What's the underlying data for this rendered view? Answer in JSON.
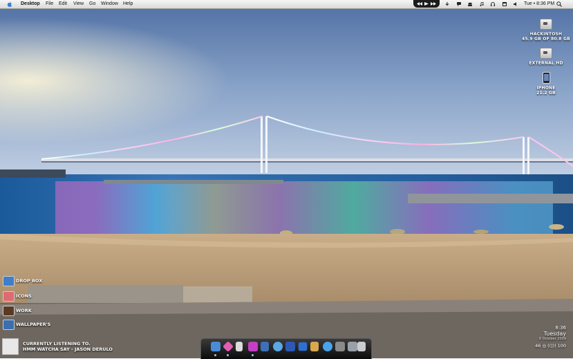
{
  "menubar": {
    "app_name": "Desktop",
    "menus": [
      "File",
      "Edit",
      "View",
      "Go",
      "Window",
      "Help"
    ],
    "clock": "Tue • 8:36 PM"
  },
  "desktop_icons": [
    {
      "name": "HACKINTOSH",
      "sub": "45.9 GB OF 80.8 GB",
      "icon": "hard-drive-icon"
    },
    {
      "name": "EXTERNAL HD",
      "sub": "",
      "icon": "hard-drive-icon"
    },
    {
      "name": "IPHONE",
      "sub": "21.2 GB",
      "icon": "iphone-icon"
    }
  ],
  "shortcuts": [
    {
      "label": "DROP BOX",
      "icon": "dropbox-icon",
      "color": "#3f7fc9"
    },
    {
      "label": "ICONS",
      "icon": "icons-folder-icon",
      "color": "#e06a72"
    },
    {
      "label": "WORK",
      "icon": "work-folder-icon",
      "color": "#5a3b22"
    },
    {
      "label": "WALLPAPER'S",
      "icon": "wallpapers-folder-icon",
      "color": "#3a6fb0"
    }
  ],
  "now_playing": {
    "heading": "CURRENTLY LISTENING TO.",
    "track": "HMM WATCHA SAY - JASON DERULO"
  },
  "widget": {
    "time": "8:36",
    "day": "Tuesday",
    "date": "6 October 2009",
    "volume": "46 ◎ ((|)) 100"
  },
  "dock_items": [
    {
      "name": "finder-icon",
      "color": "#4a8bd6"
    },
    {
      "name": "itunes-icon",
      "color": "#e45db0"
    },
    {
      "name": "ipod-icon",
      "color": "#dcdcdc"
    },
    {
      "name": "photoshop-icon",
      "color": "#c43fc4"
    },
    {
      "name": "preview-icon",
      "color": "#3e6fb8"
    },
    {
      "name": "ichat-icon",
      "color": "#5aa7e6"
    },
    {
      "name": "word-icon",
      "color": "#2d59b5"
    },
    {
      "name": "xcode-icon",
      "color": "#2f6fd0"
    },
    {
      "name": "address-book-icon",
      "color": "#d8a84e"
    },
    {
      "name": "safari-icon",
      "color": "#4aa3e8"
    },
    {
      "name": "system-preferences-icon",
      "color": "#8a8a8a"
    },
    {
      "name": "downloads-stack-icon",
      "color": "#9aa0a8"
    },
    {
      "name": "trash-icon",
      "color": "#c9ccd0"
    }
  ]
}
